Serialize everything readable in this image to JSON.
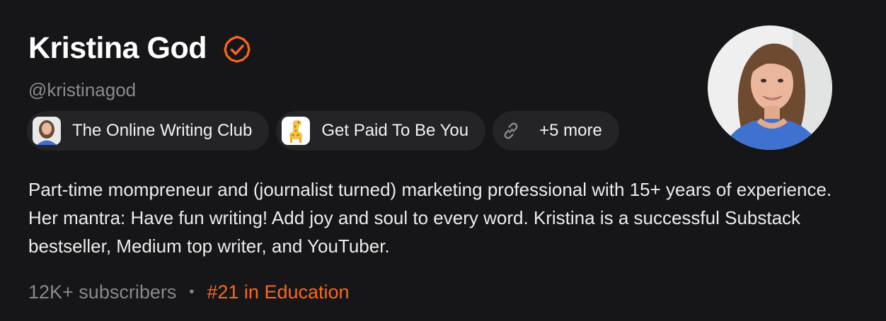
{
  "profile": {
    "name": "Kristina God",
    "handle": "@kristinagod",
    "bio": "Part-time mompreneur and (journalist turned) marketing professional with 15+ years of experience. Her mantra: Have fun writing! Add joy and soul to every word. Kristina is a successful Substack bestseller, Medium top writer, and YouTuber.",
    "subscribers": "12K+ subscribers",
    "separator": "•",
    "rank": "#21 in Education"
  },
  "publications": [
    {
      "label": "The Online Writing Club",
      "icon": "author-photo-icon"
    },
    {
      "label": "Get Paid To Be You",
      "icon": "giraffe-logo-icon"
    }
  ],
  "more_links": {
    "label": "+5 more",
    "icon": "link-icon"
  },
  "colors": {
    "background": "#161618",
    "accent": "#ff6719",
    "pill_bg": "#242427",
    "muted_text": "#8a8a8e"
  }
}
